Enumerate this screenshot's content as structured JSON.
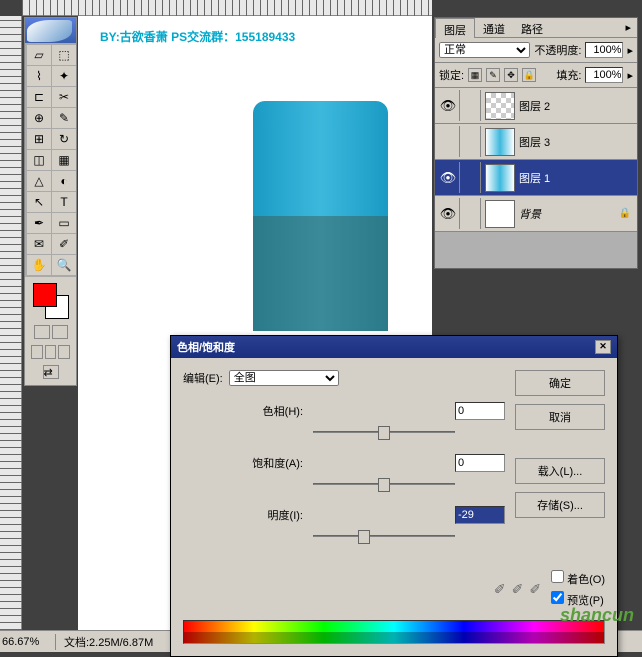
{
  "watermark": "BY:古欲香萧 PS交流群：155189433",
  "statusbar": {
    "zoom": "66.67%",
    "doc": "文档:2.25M/6.87M"
  },
  "layers": {
    "tab1": "图层",
    "tab2": "通道",
    "tab3": "路径",
    "blend": "正常",
    "opacity_label": "不透明度:",
    "opacity": "100%",
    "lock_label": "锁定:",
    "fill_label": "填充:",
    "fill": "100%",
    "items": [
      {
        "name": "图层 2"
      },
      {
        "name": "图层 3"
      },
      {
        "name": "图层 1"
      },
      {
        "name": "背景"
      }
    ]
  },
  "dialog": {
    "title": "色相/饱和度",
    "edit_label": "编辑(E):",
    "edit_value": "全图",
    "hue_label": "色相(H):",
    "hue_val": "0",
    "sat_label": "饱和度(A):",
    "sat_val": "0",
    "light_label": "明度(I):",
    "light_val": "-29",
    "ok": "确定",
    "cancel": "取消",
    "load": "载入(L)...",
    "save": "存储(S)...",
    "colorize": "着色(O)",
    "preview": "预览(P)"
  },
  "brand": "shancun"
}
